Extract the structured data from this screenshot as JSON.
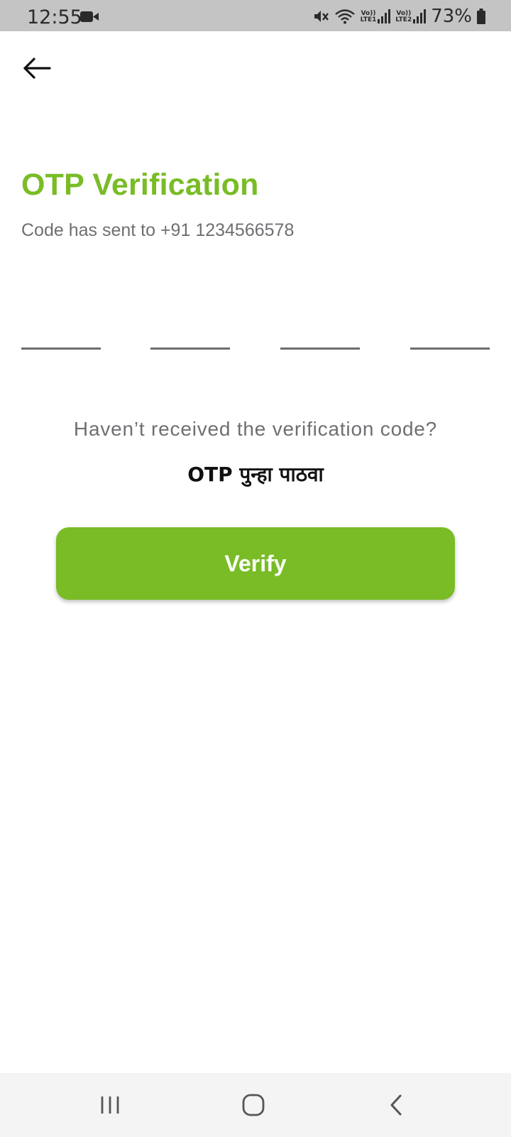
{
  "status_bar": {
    "time": "12:55",
    "battery": "73%",
    "sim1": "LTE1",
    "sim2": "LTE2",
    "volte": "Vo))"
  },
  "header": {
    "back_icon": "arrow-left-icon"
  },
  "main": {
    "title": "OTP Verification",
    "subtitle": "Code has sent to +91 1234566578",
    "otp_digits": [
      "",
      "",
      "",
      ""
    ],
    "resend_prompt": "Haven’t received the verification code?",
    "resend_link": "OTP पुन्हा पाठवा",
    "verify_label": "Verify"
  },
  "nav_bar": {
    "recents_icon": "recents-icon",
    "home_icon": "home-icon",
    "back_icon": "back-chevron-icon"
  },
  "colors": {
    "accent": "#79bc26",
    "status_bar_bg": "#c4c4c4",
    "nav_bar_bg": "#f4f4f4"
  }
}
